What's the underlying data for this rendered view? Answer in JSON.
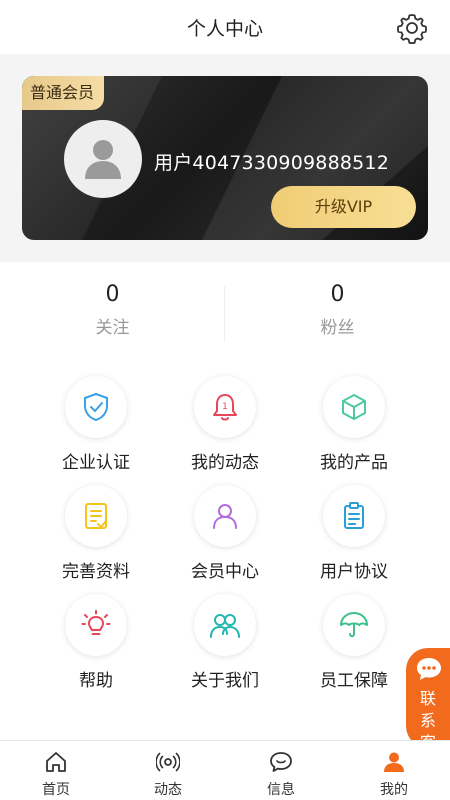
{
  "header": {
    "title": "个人中心",
    "settings_icon": "gear-icon"
  },
  "member_card": {
    "badge": "普通会员",
    "avatar_icon": "user-avatar-icon",
    "username": "用户4047330909888512",
    "upgrade_label": "升级VIP",
    "gold": "#f2cf7e"
  },
  "stats": [
    {
      "value": "0",
      "label": "关注"
    },
    {
      "value": "0",
      "label": "粉丝"
    }
  ],
  "grid": [
    {
      "label": "企业认证",
      "icon": "shield-check-icon",
      "color": "#3aa0e8"
    },
    {
      "label": "我的动态",
      "icon": "bell-icon",
      "color": "#e8465a"
    },
    {
      "label": "我的产品",
      "icon": "cube-icon",
      "color": "#4cc9a0"
    },
    {
      "label": "完善资料",
      "icon": "document-edit-icon",
      "color": "#f3c51c"
    },
    {
      "label": "会员中心",
      "icon": "person-icon",
      "color": "#b56be0"
    },
    {
      "label": "用户协议",
      "icon": "clipboard-icon",
      "color": "#2a9fd6"
    },
    {
      "label": "帮助",
      "icon": "lightbulb-icon",
      "color": "#e8465a"
    },
    {
      "label": "关于我们",
      "icon": "group-icon",
      "color": "#20b8b0"
    },
    {
      "label": "员工保障",
      "icon": "umbrella-icon",
      "color": "#3cc08a"
    }
  ],
  "contact": {
    "label": "联系客",
    "icon": "chat-bubble-icon",
    "color": "#f26b1d"
  },
  "tabs": [
    {
      "label": "首页",
      "icon": "home-icon"
    },
    {
      "label": "动态",
      "icon": "broadcast-icon"
    },
    {
      "label": "信息",
      "icon": "message-icon"
    },
    {
      "label": "我的",
      "icon": "person-filled-icon",
      "active": true,
      "active_color": "#f26b1d"
    }
  ]
}
